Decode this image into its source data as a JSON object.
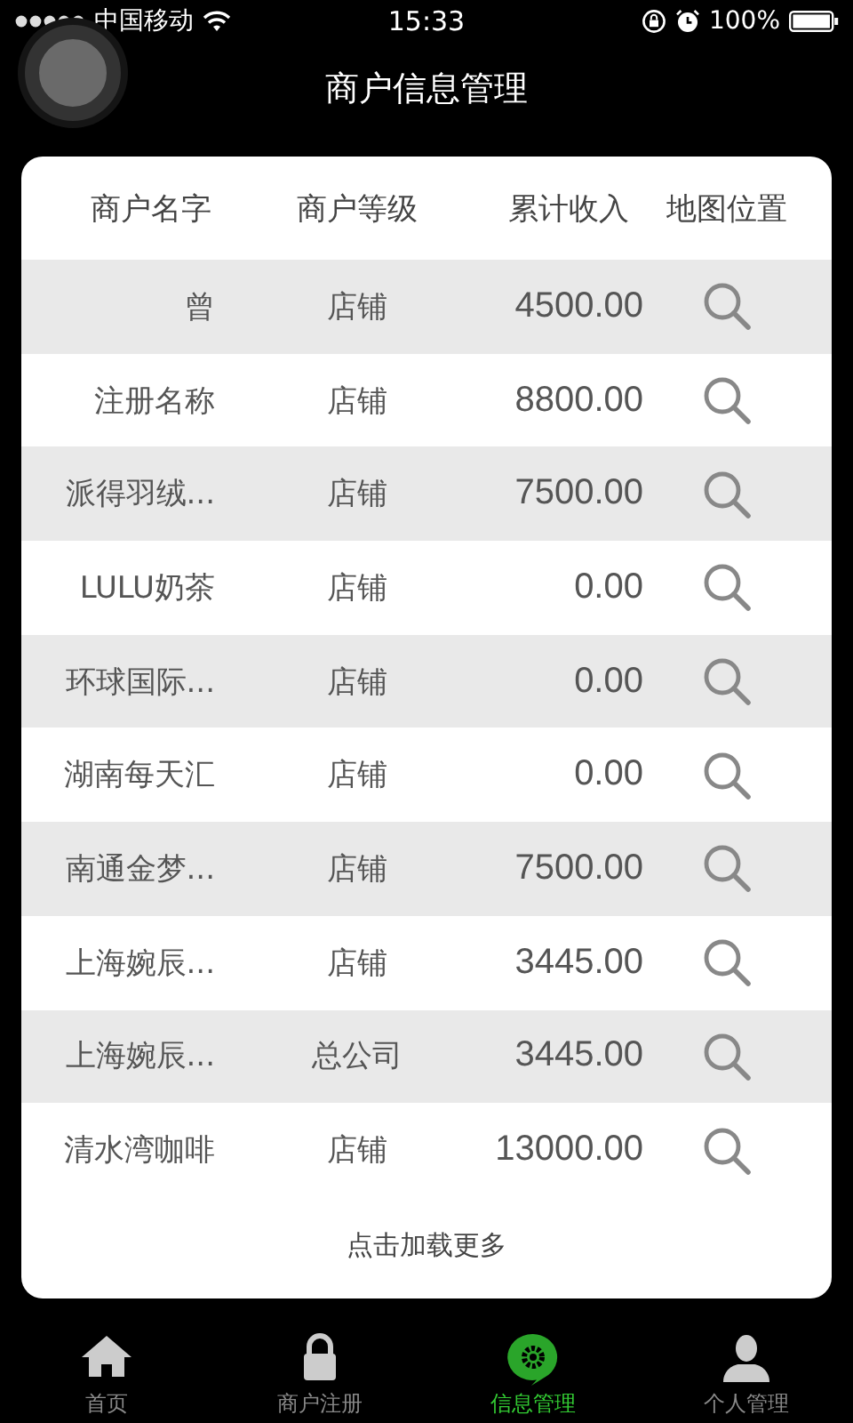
{
  "status_bar": {
    "carrier": "中国移动",
    "time": "15:33",
    "battery": "100%"
  },
  "title": "商户信息管理",
  "table": {
    "columns": [
      "商户名字",
      "商户等级",
      "累计收入",
      "地图位置"
    ],
    "rows": [
      {
        "name": "曾",
        "level": "店铺",
        "income": "4500.00"
      },
      {
        "name": "注册名称",
        "level": "店铺",
        "income": "8800.00"
      },
      {
        "name": "派得羽绒...",
        "level": "店铺",
        "income": "7500.00"
      },
      {
        "name": "LULU奶茶",
        "level": "店铺",
        "income": "0.00"
      },
      {
        "name": "环球国际...",
        "level": "店铺",
        "income": "0.00"
      },
      {
        "name": "湖南每天汇",
        "level": "店铺",
        "income": "0.00"
      },
      {
        "name": "南通金梦...",
        "level": "店铺",
        "income": "7500.00"
      },
      {
        "name": "上海婉辰...",
        "level": "店铺",
        "income": "3445.00"
      },
      {
        "name": "上海婉辰...",
        "level": "总公司",
        "income": "3445.00"
      },
      {
        "name": "清水湾咖啡",
        "level": "店铺",
        "income": "13000.00"
      }
    ]
  },
  "load_more": "点击加载更多",
  "tabs": [
    {
      "label": "首页",
      "kind": "home",
      "selected": false
    },
    {
      "label": "商户注册",
      "kind": "lock",
      "selected": false
    },
    {
      "label": "信息管理",
      "kind": "gear",
      "selected": true
    },
    {
      "label": "个人管理",
      "kind": "person",
      "selected": false
    }
  ]
}
